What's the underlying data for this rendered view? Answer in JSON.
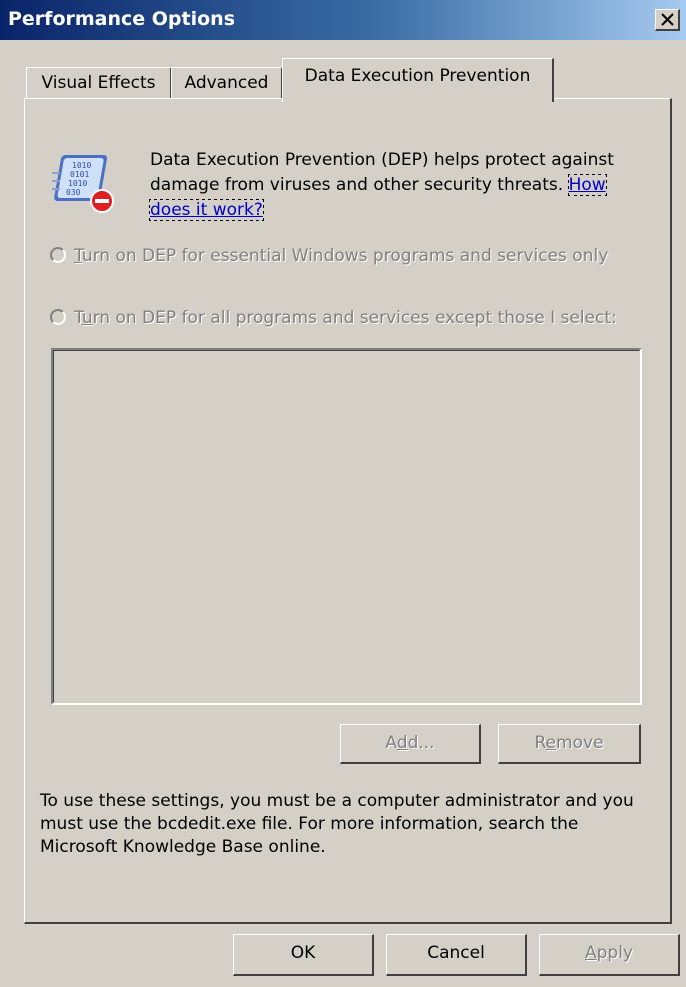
{
  "window": {
    "title": "Performance Options"
  },
  "tabs": [
    {
      "label": "Visual Effects"
    },
    {
      "label": "Advanced"
    },
    {
      "label": "Data Execution Prevention",
      "selected": true
    }
  ],
  "dep": {
    "icon": "dep-shield-binary-icon",
    "intro_text": "Data Execution Prevention (DEP) helps protect against damage from viruses and other security threats.",
    "link_text": "How does it work?",
    "options": [
      {
        "mnemonic": "T",
        "rest": "urn on DEP for essential Windows programs and services only",
        "selected": false,
        "enabled": false
      },
      {
        "prefix": "T",
        "mnemonic": "u",
        "rest": "rn on DEP for all programs and services except those I select:",
        "selected": false,
        "enabled": false
      }
    ],
    "list_items": [],
    "add_button": {
      "prefix": "A",
      "mnemonic": "d",
      "rest": "d...",
      "enabled": false
    },
    "remove_button": {
      "prefix": "R",
      "mnemonic": "e",
      "rest": "move",
      "enabled": false
    },
    "note": "To use these settings, you must be a computer administrator and you must use the bcdedit.exe file. For more information, search the Microsoft Knowledge Base online."
  },
  "footer": {
    "ok_label": "OK",
    "cancel_label": "Cancel",
    "apply": {
      "mnemonic": "A",
      "rest": "pply",
      "enabled": false
    }
  },
  "colors": {
    "dialog_bg": "#d4d0c8",
    "title_start": "#0a246a",
    "title_end": "#a6caf0",
    "link": "#0000cc",
    "disabled_text": "#808080"
  }
}
